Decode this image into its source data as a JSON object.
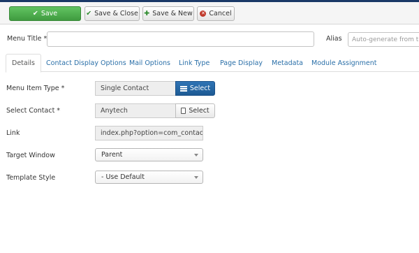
{
  "toolbar": {
    "save": "Save",
    "save_close": "Save & Close",
    "save_new": "Save & New",
    "cancel": "Cancel"
  },
  "header": {
    "menu_title_label": "Menu Title *",
    "alias_label": "Alias",
    "alias_placeholder": "Auto-generate from title"
  },
  "tabs": [
    {
      "label": "Details",
      "active": true
    },
    {
      "label": "Contact Display Options"
    },
    {
      "label": "Mail Options"
    },
    {
      "label": "Link Type"
    },
    {
      "label": "Page Display"
    },
    {
      "label": "Metadata"
    },
    {
      "label": "Module Assignment"
    }
  ],
  "form": {
    "menu_item_type": {
      "label": "Menu Item Type *",
      "value": "Single Contact",
      "button": "Select"
    },
    "select_contact": {
      "label": "Select Contact *",
      "value": "Anytech",
      "button": "Select"
    },
    "link": {
      "label": "Link",
      "value": "index.php?option=com_contact&view=contact"
    },
    "target_window": {
      "label": "Target Window",
      "value": "Parent"
    },
    "template_style": {
      "label": "Template Style",
      "value": "- Use Default"
    }
  },
  "colors": {
    "accent_blue": "#1d5a94",
    "save_green": "#51a351",
    "top_bar": "#1a3867",
    "tab_link": "#2a6fa8"
  }
}
